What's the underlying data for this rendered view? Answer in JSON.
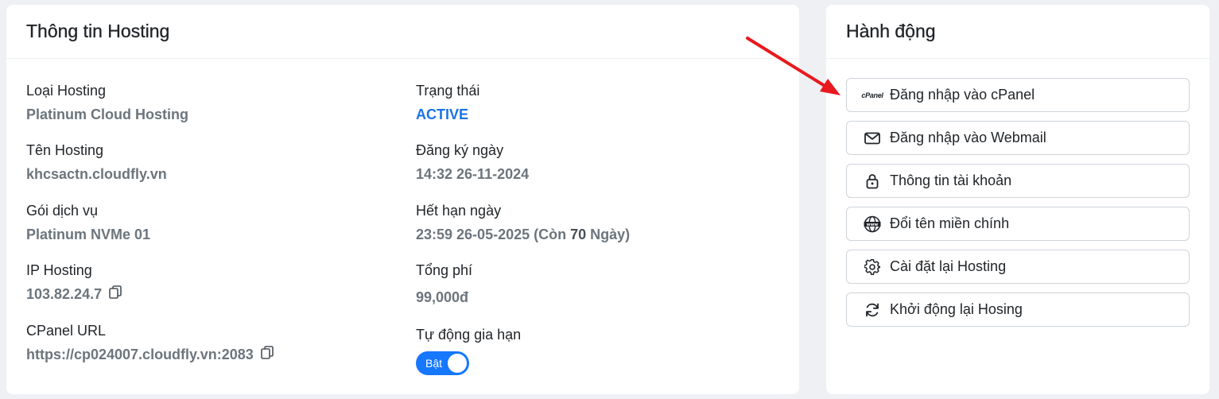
{
  "info_card": {
    "title": "Thông tin Hosting",
    "fields": {
      "hosting_type": {
        "label": "Loại Hosting",
        "value": "Platinum Cloud Hosting"
      },
      "hosting_name": {
        "label": "Tên Hosting",
        "value": "khcsactn.cloudfly.vn"
      },
      "service_plan": {
        "label": "Gói dịch vụ",
        "value": "Platinum NVMe 01"
      },
      "ip_hosting": {
        "label": "IP Hosting",
        "value": "103.82.24.7"
      },
      "cpanel_url": {
        "label": "CPanel URL",
        "value": "https://cp024007.cloudfly.vn:2083"
      },
      "status": {
        "label": "Trạng thái",
        "value": "ACTIVE"
      },
      "registered": {
        "label": "Đăng ký ngày",
        "value": "14:32 26-11-2024"
      },
      "expires": {
        "label": "Hết hạn ngày",
        "value_prefix": "23:59 26-05-2025 (Còn ",
        "days": "70",
        "value_suffix": " Ngày)"
      },
      "total_fee": {
        "label": "Tổng phí",
        "value": "99,000đ"
      },
      "auto_renew": {
        "label": "Tự động gia hạn",
        "toggle_label": "Bật",
        "enabled": true
      }
    }
  },
  "actions_card": {
    "title": "Hành động",
    "cpanel_icon_text": "cPanel",
    "buttons": [
      {
        "icon": "cpanel-logo-icon",
        "label": "Đăng nhập vào cPanel"
      },
      {
        "icon": "mail-icon",
        "label": "Đăng nhập vào Webmail"
      },
      {
        "icon": "lock-icon",
        "label": "Thông tin tài khoản"
      },
      {
        "icon": "globe-www-icon",
        "label": "Đổi tên miền chính"
      },
      {
        "icon": "gear-icon",
        "label": "Cài đặt lại Hosting"
      },
      {
        "icon": "refresh-icon",
        "label": "Khởi động lại Hosing"
      }
    ]
  },
  "colors": {
    "accent": "#1677ff",
    "status_active": "#1a73e8",
    "muted_value": "#6c757d",
    "annotation_arrow": "#e8191f"
  }
}
